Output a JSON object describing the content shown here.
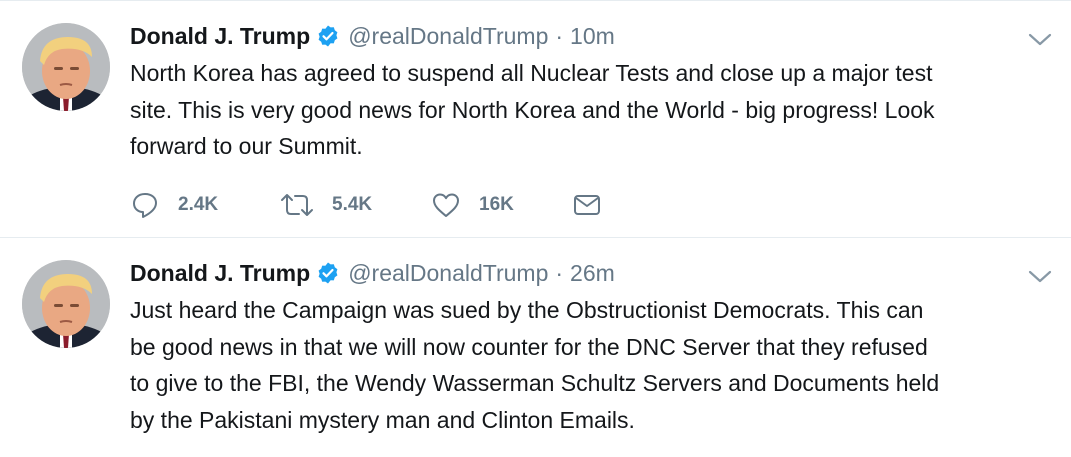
{
  "tweets": [
    {
      "name": "Donald J. Trump",
      "handle": "@realDonaldTrump",
      "separator": "·",
      "time": "10m",
      "text_lines": [
        "North Korea has agreed to suspend all Nuclear Tests and close up a major test",
        "site. This is very good news for North Korea and the World - big progress! Look",
        "forward to our Summit."
      ],
      "replies": "2.4K",
      "retweets": "5.4K",
      "likes": "16K"
    },
    {
      "name": "Donald J. Trump",
      "handle": "@realDonaldTrump",
      "separator": "·",
      "time": "26m",
      "text_lines": [
        "Just heard the Campaign was sued by the Obstructionist Democrats. This can",
        "be good news in that we will now counter for the DNC Server that they refused",
        "to give to the FBI, the Wendy Wasserman Schultz Servers and Documents held",
        "by the Pakistani mystery man and Clinton Emails."
      ]
    }
  ],
  "icons": {
    "verified": "verified-badge-icon",
    "caret": "chevron-down-icon",
    "reply": "reply-icon",
    "retweet": "retweet-icon",
    "like": "heart-icon",
    "message": "envelope-icon"
  },
  "colors": {
    "verified_blue": "#1da1f2",
    "secondary_text": "#657786",
    "primary_text": "#14171a",
    "divider": "#e6ecf0"
  }
}
